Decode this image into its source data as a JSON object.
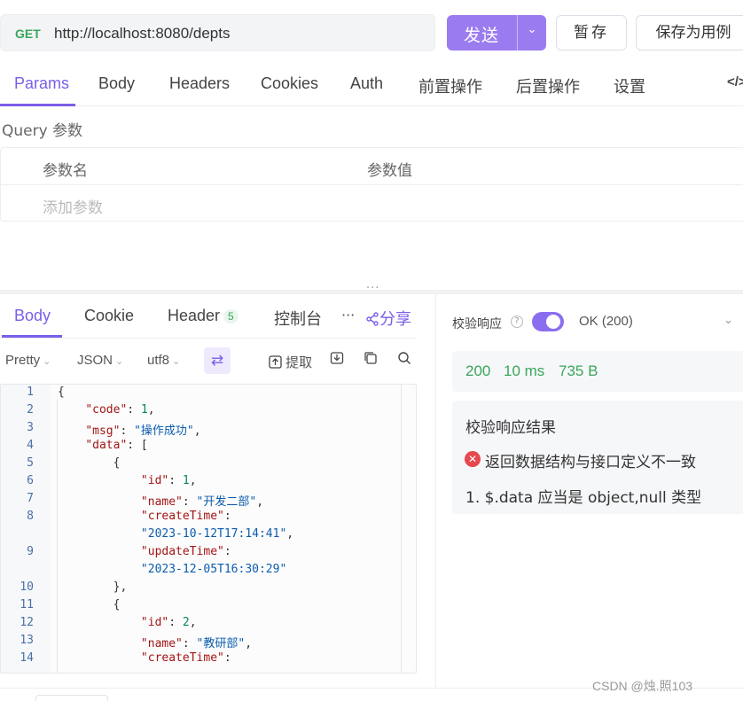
{
  "request": {
    "method": "GET",
    "url": "http://localhost:8080/depts",
    "send_label": "发送",
    "save_label": "暂存",
    "save_as_label": "保存为用例"
  },
  "request_tabs": [
    "Params",
    "Body",
    "Headers",
    "Cookies",
    "Auth",
    "前置操作",
    "后置操作",
    "设置",
    "</>"
  ],
  "query": {
    "title": "Query 参数",
    "col_name": "参数名",
    "col_value": "参数值",
    "add_placeholder": "添加参数"
  },
  "response_tabs": {
    "body": "Body",
    "cookie": "Cookie",
    "header": "Header",
    "header_count": "5",
    "console": "控制台",
    "more": "···",
    "share": "分享"
  },
  "toolbar": {
    "pretty": "Pretty",
    "format": "JSON",
    "encoding": "utf8",
    "extract": "提取"
  },
  "code_lines": [
    {
      "n": "1",
      "t": "{"
    },
    {
      "n": "2",
      "t": "    \"code\": 1,"
    },
    {
      "n": "3",
      "t": "    \"msg\": \"操作成功\","
    },
    {
      "n": "4",
      "t": "    \"data\": ["
    },
    {
      "n": "5",
      "t": "        {"
    },
    {
      "n": "6",
      "t": "            \"id\": 1,"
    },
    {
      "n": "7",
      "t": "            \"name\": \"开发二部\","
    },
    {
      "n": "8",
      "t": "            \"createTime\":"
    },
    {
      "n": "",
      "t": "            \"2023-10-12T17:14:41\","
    },
    {
      "n": "9",
      "t": "            \"updateTime\":"
    },
    {
      "n": "",
      "t": "            \"2023-12-05T16:30:29\""
    },
    {
      "n": "10",
      "t": "        },"
    },
    {
      "n": "11",
      "t": "        {"
    },
    {
      "n": "12",
      "t": "            \"id\": 2,"
    },
    {
      "n": "13",
      "t": "            \"name\": \"教研部\","
    },
    {
      "n": "14",
      "t": "            \"createTime\":"
    }
  ],
  "validation": {
    "label": "校验响应",
    "status": "OK (200)",
    "enabled": true
  },
  "stats": {
    "code": "200",
    "time": "10 ms",
    "size": "735 B"
  },
  "result": {
    "title": "校验响应结果",
    "error": "返回数据结构与接口定义不一致",
    "detail": "1. $.data 应当是 object,null 类型"
  },
  "watermark": "CSDN @烛.照103",
  "colors": {
    "accent": "#7b5ee8",
    "send_button": "#9b7cf0",
    "success": "#3aa65a",
    "error": "#e5484d"
  }
}
